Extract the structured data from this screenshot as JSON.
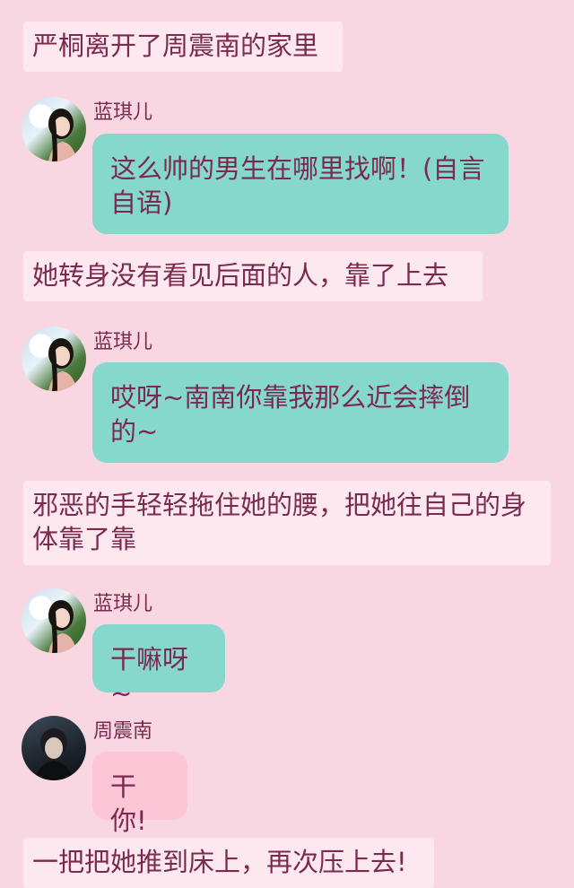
{
  "colors": {
    "background": "#f8d7e3",
    "narration_bg": "#fde8f0",
    "text": "#7a2a4e",
    "bubble_teal": "#86d8cc",
    "bubble_pink": "#fcc6d6"
  },
  "messages": [
    {
      "type": "narration",
      "text": "严桐离开了周震南的家里"
    },
    {
      "type": "chat",
      "sender": "蓝琪儿",
      "avatar": "girl-avatar",
      "text": "这么帅的男生在哪里找啊！(自言自语)"
    },
    {
      "type": "narration",
      "text": "她转身没有看见后面的人，靠了上去"
    },
    {
      "type": "chat",
      "sender": "蓝琪儿",
      "avatar": "girl-avatar",
      "text": "哎呀~南南你靠我那么近会摔倒的~"
    },
    {
      "type": "narration",
      "text": "邪恶的手轻轻拖住她的腰，把她往自己的身体靠了靠"
    },
    {
      "type": "chat",
      "sender": "蓝琪儿",
      "avatar": "girl-avatar",
      "text": "干嘛呀~"
    },
    {
      "type": "chat",
      "sender": "周震南",
      "avatar": "boy-avatar",
      "text": "干你!"
    },
    {
      "type": "narration",
      "text": "一把把她推到床上，再次压上去!"
    }
  ]
}
